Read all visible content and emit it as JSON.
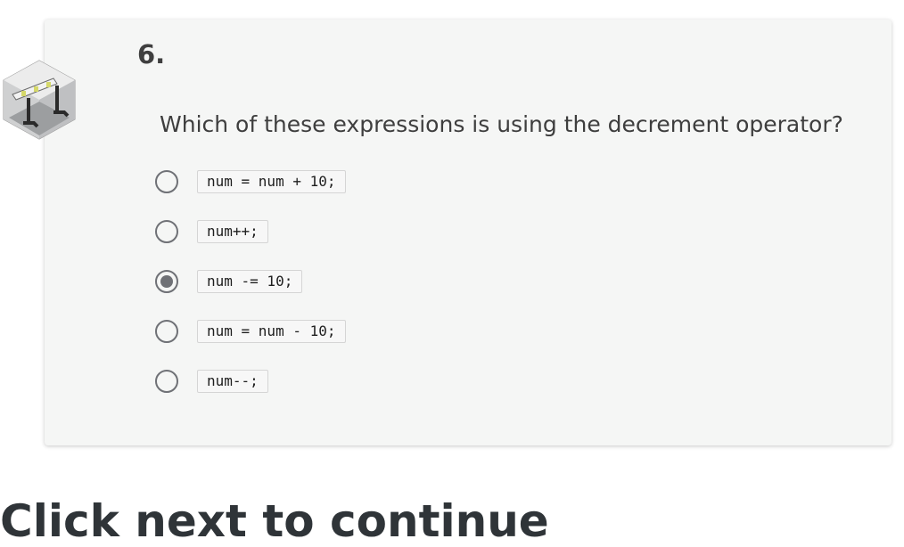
{
  "question": {
    "number": "6.",
    "text": "Which of these expressions is using the decrement operator?",
    "options": [
      {
        "label": "num = num + 10;",
        "selected": false
      },
      {
        "label": "num++;",
        "selected": false
      },
      {
        "label": "num -= 10;",
        "selected": true
      },
      {
        "label": "num = num - 10;",
        "selected": false
      },
      {
        "label": "num--;",
        "selected": false
      }
    ]
  },
  "badge_icon": "hurdle-room-icon",
  "next_section_heading": "Click next to continue",
  "colors": {
    "card_background": "#f5f6f5",
    "radio_border": "#6f7176",
    "text": "#3e3e3e"
  }
}
